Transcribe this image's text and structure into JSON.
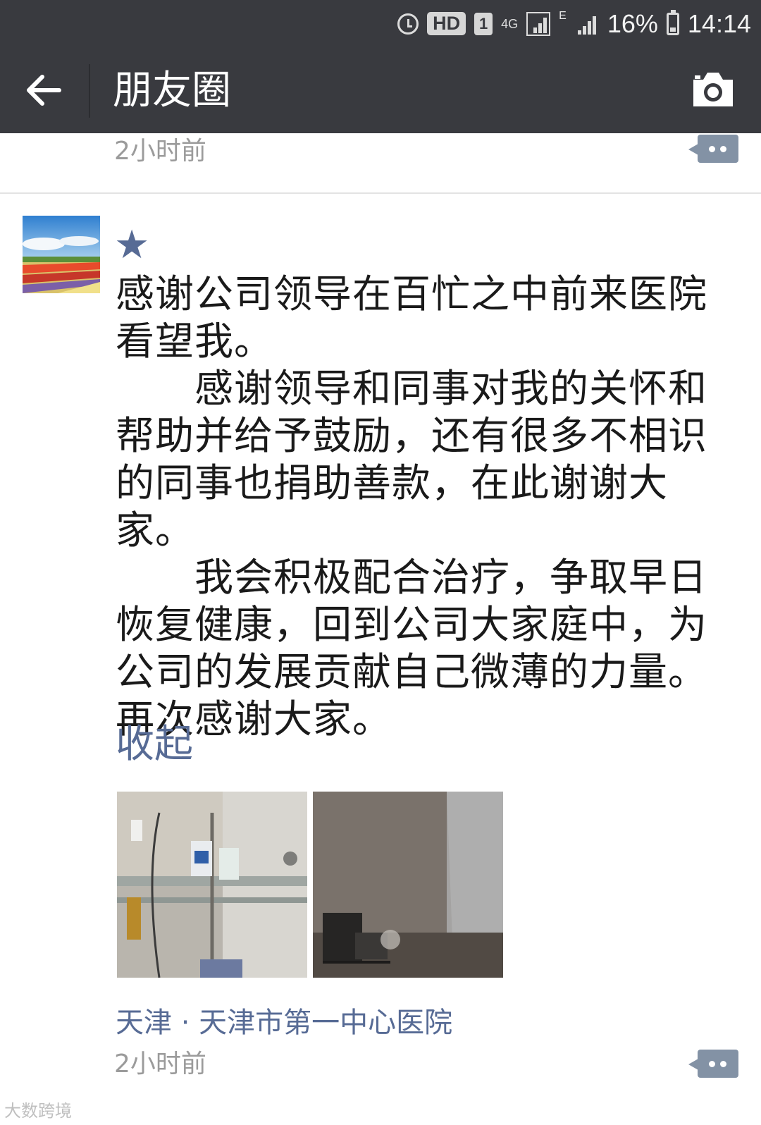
{
  "status_bar": {
    "hd": "HD",
    "sim": "1",
    "network": "4G",
    "network2": "E",
    "battery": "16%",
    "time": "14:14"
  },
  "header": {
    "title": "朋友圈",
    "back_icon": "back-arrow-icon",
    "camera_icon": "camera-icon",
    "background": "#393a3f"
  },
  "previous_post": {
    "time": "2小时前"
  },
  "post": {
    "nickname": "★",
    "text": "感谢公司领导在百忙之中前来医院看望我。\n　　感谢领导和同事对我的关怀和帮助并给予鼓励，还有很多不相识的同事也捐助善款，在此谢谢大家。\n　　我会积极配合治疗，争取早日恢复健康，回到公司大家庭中，为公司的发展贡献自己微薄的力量。再次感谢大家。",
    "collapse_label": "收起",
    "location": "天津 · 天津市第一中心医院",
    "time": "2小时前",
    "link_color": "#576b95"
  },
  "watermark": "大数跨境"
}
